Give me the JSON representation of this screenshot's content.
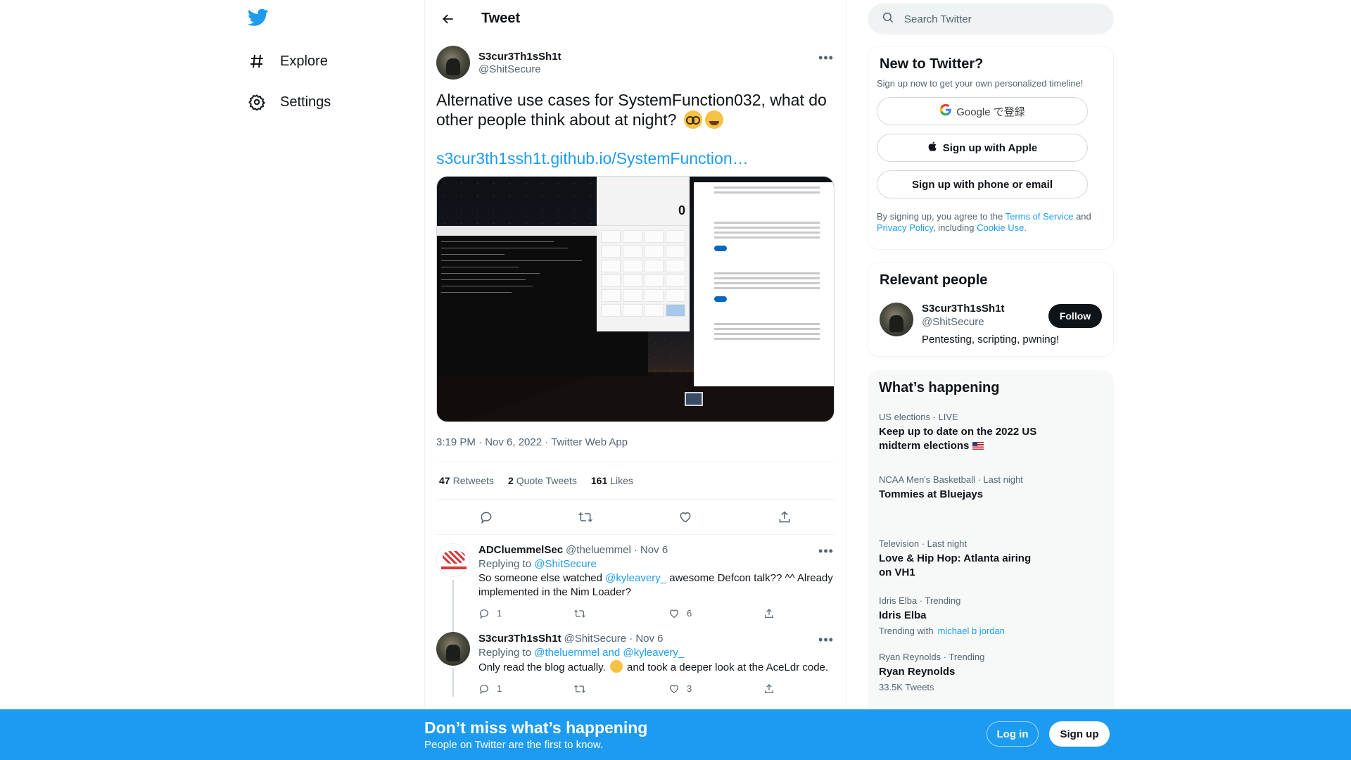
{
  "nav": {
    "items": [
      {
        "label": "Explore",
        "icon": "hashtag-icon"
      },
      {
        "label": "Settings",
        "icon": "gear-icon"
      }
    ]
  },
  "header": {
    "title": "Tweet"
  },
  "tweet": {
    "author_name": "S3cur3Th1sSh1t",
    "author_handle": "@ShitSecure",
    "text": "Alternative use cases for SystemFunction032, what do other people think about at night?",
    "emojis": [
      "nerd-face",
      "grinning-sweat"
    ],
    "link": "s3cur3th1ssh1t.github.io/SystemFunction…",
    "timestamp": "3:19 PM · Nov 6, 2022 · Twitter Web App",
    "media": {
      "calc_display": "0"
    },
    "stats": [
      {
        "count": "47",
        "label": "Retweets"
      },
      {
        "count": "2",
        "label": "Quote Tweets"
      },
      {
        "count": "161",
        "label": "Likes"
      }
    ]
  },
  "replies": [
    {
      "name": "ADCluemmelSec",
      "handle": "@theluemmel",
      "date": "· Nov 6",
      "replying_prefix": "Replying to",
      "replying_to": "@ShitSecure",
      "text_before": "So someone else watched",
      "mention": "@kyleavery_",
      "text_after": "awesome Defcon talk?? ^^ Already implemented in the Nim Loader?",
      "replies": "1",
      "retweets": "",
      "likes": "6"
    },
    {
      "name": "S3cur3Th1sSh1t",
      "handle": "@ShitSecure",
      "date": "· Nov 6",
      "replying_prefix": "Replying to",
      "replying_to": "@theluemmel and @kyleavery_",
      "text_before": "Only read the blog actually.",
      "text_after": "and took a deeper look at the AceLdr code.",
      "replies": "1",
      "retweets": "",
      "likes": "3"
    }
  ],
  "search": {
    "placeholder": "Search Twitter"
  },
  "new_to_twitter": {
    "title": "New to Twitter?",
    "subtitle": "Sign up now to get your own personalized timeline!",
    "google_label": "Google で登録",
    "apple_label": "Sign up with Apple",
    "phone_label": "Sign up with phone or email",
    "terms_prefix": "By signing up, you agree to the",
    "terms_link": "Terms of Service",
    "terms_and": "and",
    "privacy_link": "Privacy Policy",
    "including": ", including",
    "cookie_link": "Cookie Use."
  },
  "relevant": {
    "title": "Relevant people",
    "name": "S3cur3Th1sSh1t",
    "handle": "@ShitSecure",
    "bio": "Pentesting, scripting, pwning!",
    "follow_label": "Follow"
  },
  "happening": {
    "title": "What’s happening",
    "trends": [
      {
        "context": "US elections · LIVE",
        "title": "Keep up to date on the 2022 US midterm elections",
        "extra": ""
      },
      {
        "context": "NCAA Men's Basketball · Last night",
        "title": "Tommies at Bluejays",
        "extra": ""
      },
      {
        "context": "Television · Last night",
        "title": "Love & Hip Hop: Atlanta airing on VH1",
        "extra": ""
      },
      {
        "context": "Idris Elba · Trending",
        "title": "Idris Elba",
        "extra": "Trending with",
        "extra_link": "michael b jordan"
      },
      {
        "context": "Ryan Reynolds · Trending",
        "title": "Ryan Reynolds",
        "extra": "33.5K Tweets"
      }
    ]
  },
  "bottom_bar": {
    "title": "Don’t miss what’s happening",
    "subtitle": "People on Twitter are the first to know.",
    "login": "Log in",
    "signup": "Sign up"
  },
  "colors": {
    "accent": "#1d9bf0",
    "text": "#0f1419",
    "muted": "#536471"
  }
}
